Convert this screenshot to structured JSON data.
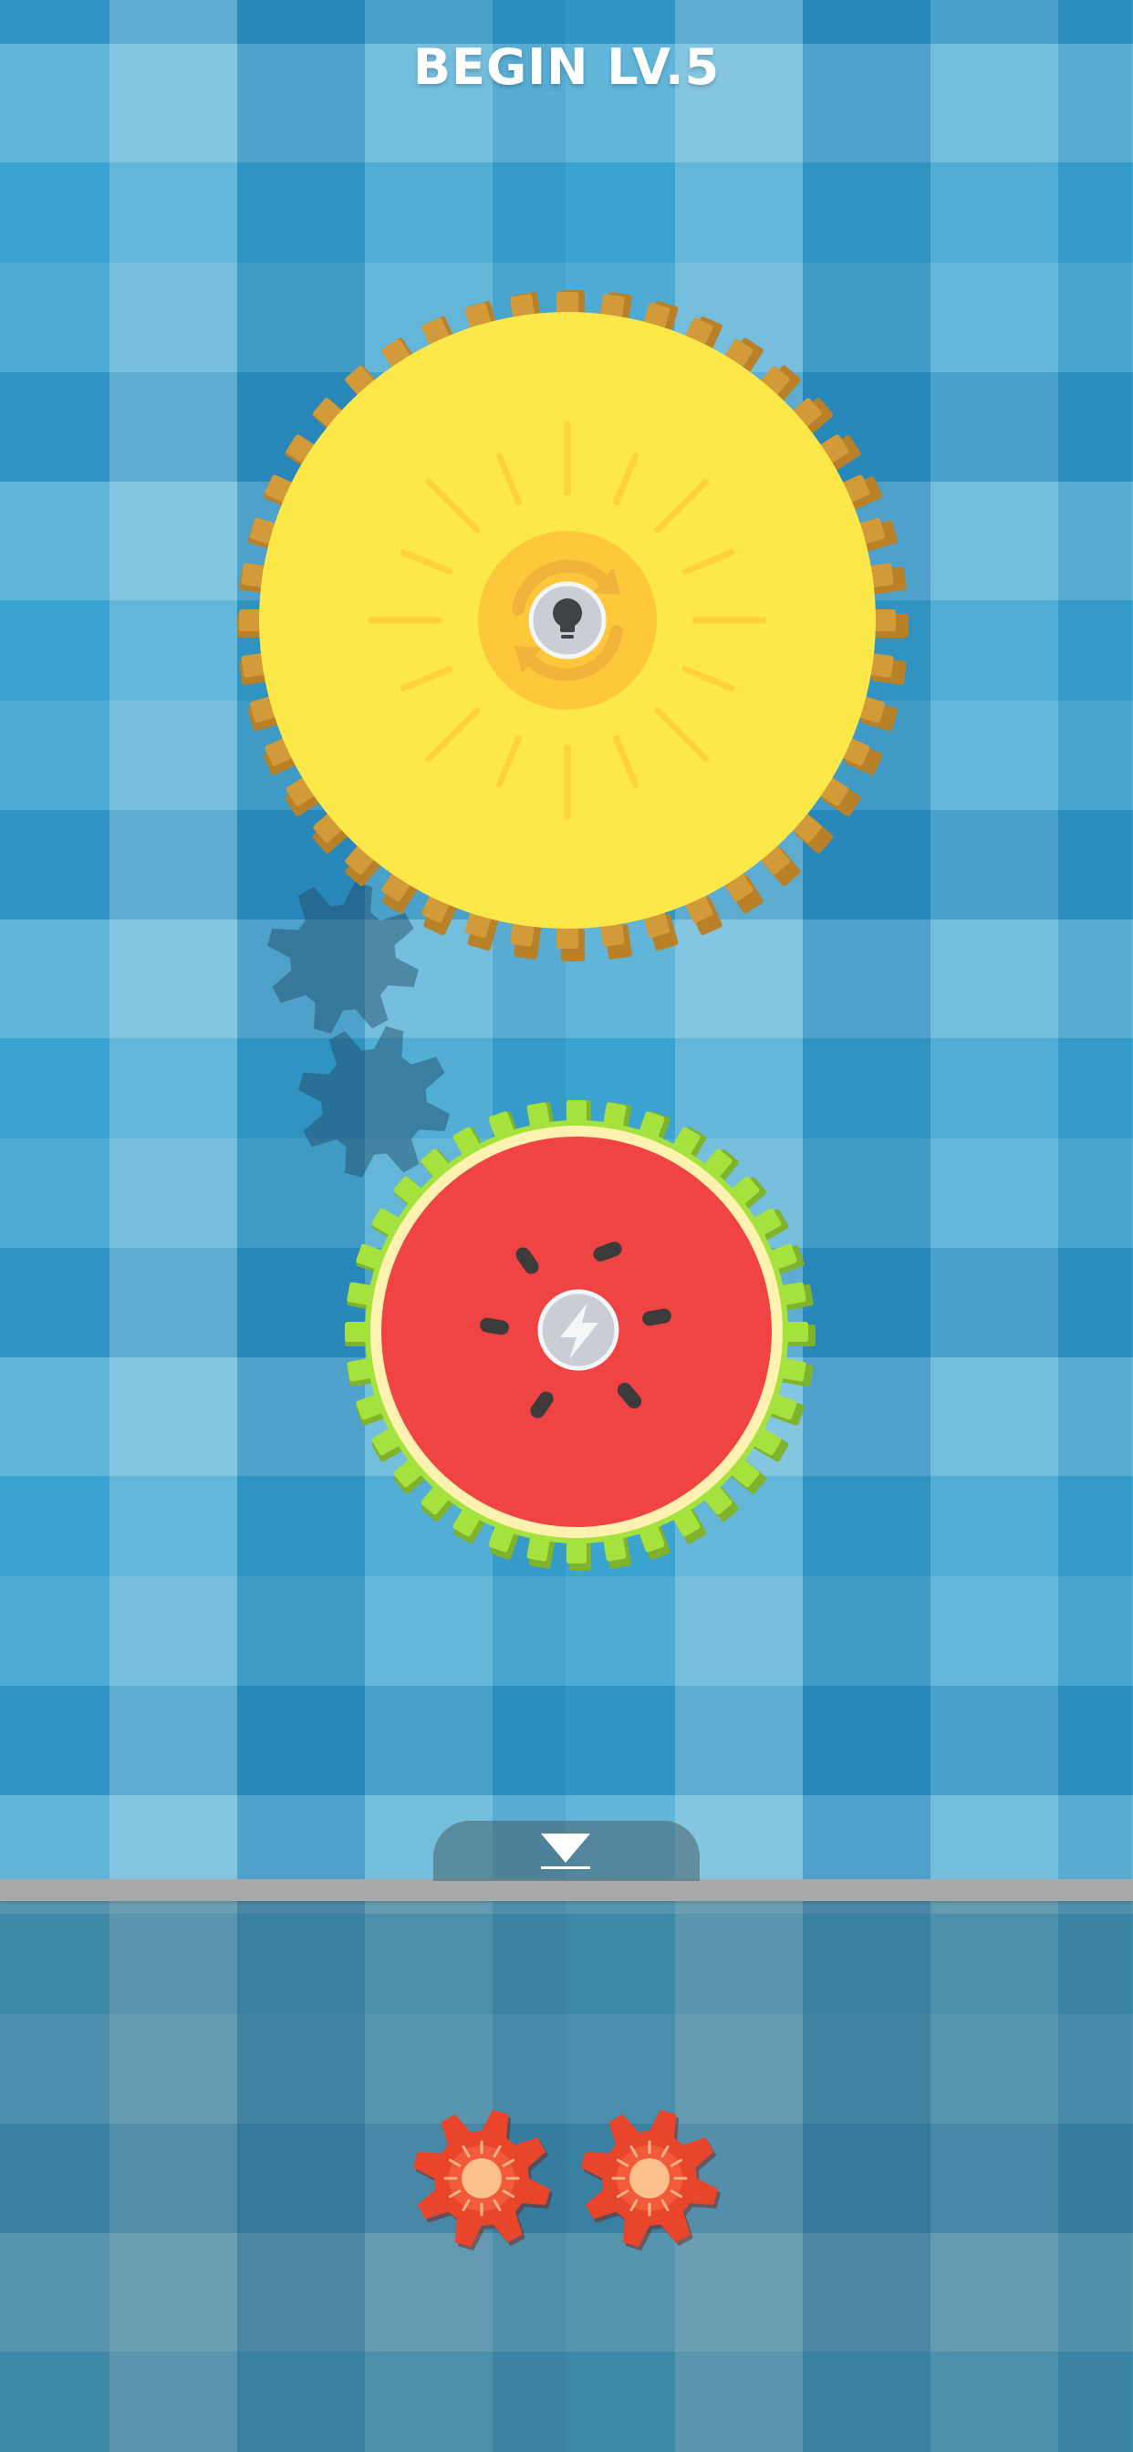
{
  "header": {
    "level_title": "BEGIN LV.5"
  },
  "board": {
    "big_gear": {
      "color": "#fde84a",
      "teeth_color": "#b88127",
      "center_color": "#ffc83a",
      "icon": "lightbulb-icon",
      "swap_icon": "rotate-arrows-icon"
    },
    "melon_gear": {
      "flesh_color": "#f04344",
      "rind_color": "#fff2b0",
      "teeth_color": "#a6e23e",
      "icon": "lightning-icon"
    },
    "empty_slots": 2
  },
  "tray": {
    "toggle_icon": "chevron-down-icon",
    "bar_color": "#a7a9aa",
    "pieces": [
      {
        "type": "small-red-gear",
        "color": "#e8452b"
      },
      {
        "type": "small-red-gear",
        "color": "#e8452b"
      }
    ]
  },
  "colors": {
    "background": "#3aa3cf"
  }
}
